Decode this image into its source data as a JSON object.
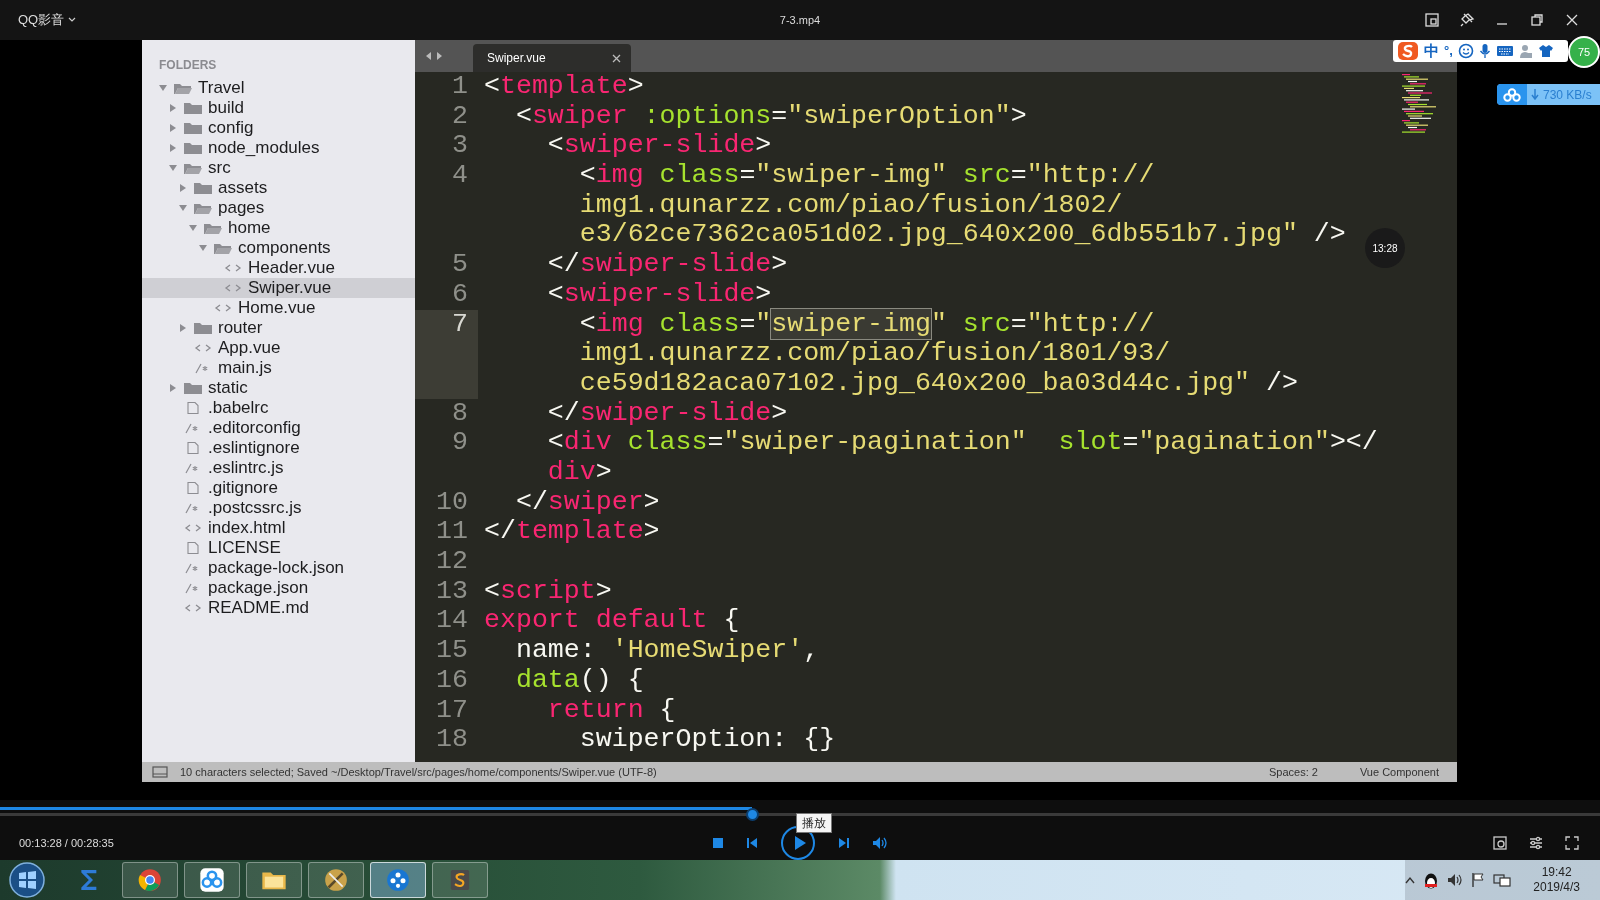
{
  "player": {
    "title": "QQ影音",
    "file": "7-3.mp4"
  },
  "editor": {
    "tab": {
      "label": "Swiper.vue"
    },
    "sidebar": {
      "heading": "FOLDERS",
      "items": [
        {
          "label": "Travel",
          "kind": "folder",
          "expanded": true,
          "selected": false,
          "children": [
            {
              "label": "build",
              "kind": "folder",
              "expanded": false,
              "selected": false
            },
            {
              "label": "config",
              "kind": "folder",
              "expanded": false,
              "selected": false
            },
            {
              "label": "node_modules",
              "kind": "folder",
              "expanded": false,
              "selected": false
            },
            {
              "label": "src",
              "kind": "folder",
              "expanded": true,
              "selected": false,
              "children": [
                {
                  "label": "assets",
                  "kind": "folder",
                  "expanded": false,
                  "selected": false
                },
                {
                  "label": "pages",
                  "kind": "folder",
                  "expanded": true,
                  "selected": false,
                  "children": [
                    {
                      "label": "home",
                      "kind": "folder",
                      "expanded": true,
                      "selected": false,
                      "children": [
                        {
                          "label": "components",
                          "kind": "folder",
                          "expanded": true,
                          "selected": false,
                          "children": [
                            {
                              "label": "Header.vue",
                              "kind": "markup",
                              "selected": false
                            },
                            {
                              "label": "Swiper.vue",
                              "kind": "markup",
                              "selected": true
                            }
                          ]
                        },
                        {
                          "label": "Home.vue",
                          "kind": "markup",
                          "selected": false
                        }
                      ]
                    }
                  ]
                },
                {
                  "label": "router",
                  "kind": "folder",
                  "expanded": false,
                  "selected": false
                },
                {
                  "label": "App.vue",
                  "kind": "markup",
                  "selected": false
                },
                {
                  "label": "main.js",
                  "kind": "script",
                  "selected": false
                }
              ]
            },
            {
              "label": "static",
              "kind": "folder",
              "expanded": false,
              "selected": false
            },
            {
              "label": ".babelrc",
              "kind": "text",
              "selected": false
            },
            {
              "label": ".editorconfig",
              "kind": "script",
              "selected": false
            },
            {
              "label": ".eslintignore",
              "kind": "text",
              "selected": false
            },
            {
              "label": ".eslintrc.js",
              "kind": "script",
              "selected": false
            },
            {
              "label": ".gitignore",
              "kind": "text",
              "selected": false
            },
            {
              "label": ".postcssrc.js",
              "kind": "script",
              "selected": false
            },
            {
              "label": "index.html",
              "kind": "markup",
              "selected": false
            },
            {
              "label": "LICENSE",
              "kind": "text",
              "selected": false
            },
            {
              "label": "package-lock.json",
              "kind": "script",
              "selected": false
            },
            {
              "label": "package.json",
              "kind": "script",
              "selected": false
            },
            {
              "label": "README.md",
              "kind": "markup",
              "selected": false
            }
          ]
        }
      ]
    },
    "lines": [
      {
        "number": "1",
        "current": false,
        "rows": [
          {
            "tokens": [
              {
                "kind": "plain",
                "text": "<"
              },
              {
                "kind": "tag",
                "text": "template"
              },
              {
                "kind": "plain",
                "text": ">"
              }
            ]
          }
        ]
      },
      {
        "number": "2",
        "current": false,
        "rows": [
          {
            "tokens": [
              {
                "kind": "plain",
                "text": "  <"
              },
              {
                "kind": "tag",
                "text": "swiper"
              },
              {
                "kind": "attr",
                "text": " :options"
              },
              {
                "kind": "plain",
                "text": "="
              },
              {
                "kind": "string",
                "text": "\"swiperOption\""
              },
              {
                "kind": "plain",
                "text": ">"
              }
            ]
          }
        ]
      },
      {
        "number": "3",
        "current": false,
        "rows": [
          {
            "tokens": [
              {
                "kind": "plain",
                "text": "    <"
              },
              {
                "kind": "tag",
                "text": "swiper-slide"
              },
              {
                "kind": "plain",
                "text": ">"
              }
            ]
          }
        ]
      },
      {
        "number": "4",
        "current": false,
        "rows": [
          {
            "tokens": [
              {
                "kind": "plain",
                "text": "      <"
              },
              {
                "kind": "tag",
                "text": "img"
              },
              {
                "kind": "attr",
                "text": " class"
              },
              {
                "kind": "plain",
                "text": "="
              },
              {
                "kind": "string",
                "text": "\"swiper-img\""
              },
              {
                "kind": "attr",
                "text": " src"
              },
              {
                "kind": "plain",
                "text": "="
              },
              {
                "kind": "string",
                "text": "\"http://"
              }
            ]
          },
          {
            "tokens": [
              {
                "kind": "string",
                "text": "      img1.qunarzz.com/piao/fusion/1802/"
              }
            ]
          },
          {
            "tokens": [
              {
                "kind": "string",
                "text": "      e3/62ce7362ca051d02.jpg_640x200_6db551b7.jpg\""
              },
              {
                "kind": "plain",
                "text": " />"
              }
            ]
          }
        ]
      },
      {
        "number": "5",
        "current": false,
        "rows": [
          {
            "tokens": [
              {
                "kind": "plain",
                "text": "    </"
              },
              {
                "kind": "tag",
                "text": "swiper-slide"
              },
              {
                "kind": "plain",
                "text": ">"
              }
            ]
          }
        ]
      },
      {
        "number": "6",
        "current": false,
        "rows": [
          {
            "tokens": [
              {
                "kind": "plain",
                "text": "    <"
              },
              {
                "kind": "tag",
                "text": "swiper-slide"
              },
              {
                "kind": "plain",
                "text": ">"
              }
            ]
          }
        ]
      },
      {
        "number": "7",
        "current": true,
        "rows": [
          {
            "tokens": [
              {
                "kind": "plain",
                "text": "      <"
              },
              {
                "kind": "tag",
                "text": "img"
              },
              {
                "kind": "attr",
                "text": " class"
              },
              {
                "kind": "plain",
                "text": "="
              },
              {
                "kind": "string",
                "text": "\""
              },
              {
                "kind": "selection",
                "text": "swiper-img"
              },
              {
                "kind": "string",
                "text": "\""
              },
              {
                "kind": "attr",
                "text": " src"
              },
              {
                "kind": "plain",
                "text": "="
              },
              {
                "kind": "string",
                "text": "\"http://"
              }
            ]
          },
          {
            "tokens": [
              {
                "kind": "string",
                "text": "      img1.qunarzz.com/piao/fusion/1801/93/"
              }
            ]
          },
          {
            "tokens": [
              {
                "kind": "string",
                "text": "      ce59d182aca07102.jpg_640x200_ba03d44c.jpg\""
              },
              {
                "kind": "plain",
                "text": " />"
              }
            ]
          }
        ]
      },
      {
        "number": "8",
        "current": false,
        "rows": [
          {
            "tokens": [
              {
                "kind": "plain",
                "text": "    </"
              },
              {
                "kind": "tag",
                "text": "swiper-slide"
              },
              {
                "kind": "plain",
                "text": ">"
              }
            ]
          }
        ]
      },
      {
        "number": "9",
        "current": false,
        "rows": [
          {
            "tokens": [
              {
                "kind": "plain",
                "text": "    <"
              },
              {
                "kind": "tag",
                "text": "div"
              },
              {
                "kind": "attr",
                "text": " class"
              },
              {
                "kind": "plain",
                "text": "="
              },
              {
                "kind": "string",
                "text": "\"swiper-pagination\""
              },
              {
                "kind": "attr",
                "text": "  slot"
              },
              {
                "kind": "plain",
                "text": "="
              },
              {
                "kind": "string",
                "text": "\"pagination\""
              },
              {
                "kind": "plain",
                "text": "></"
              }
            ]
          },
          {
            "tokens": [
              {
                "kind": "tag",
                "text": "    div"
              },
              {
                "kind": "plain",
                "text": ">"
              }
            ]
          }
        ]
      },
      {
        "number": "10",
        "current": false,
        "rows": [
          {
            "tokens": [
              {
                "kind": "plain",
                "text": "  </"
              },
              {
                "kind": "tag",
                "text": "swiper"
              },
              {
                "kind": "plain",
                "text": ">"
              }
            ]
          }
        ]
      },
      {
        "number": "11",
        "current": false,
        "rows": [
          {
            "tokens": [
              {
                "kind": "plain",
                "text": "</"
              },
              {
                "kind": "tag",
                "text": "template"
              },
              {
                "kind": "plain",
                "text": ">"
              }
            ]
          }
        ]
      },
      {
        "number": "12",
        "current": false
      },
      {
        "number": "13",
        "current": false,
        "rows": [
          {
            "tokens": [
              {
                "kind": "plain",
                "text": "<"
              },
              {
                "kind": "tag",
                "text": "script"
              },
              {
                "kind": "plain",
                "text": ">"
              }
            ]
          }
        ]
      },
      {
        "number": "14",
        "current": false,
        "rows": [
          {
            "tokens": [
              {
                "kind": "keyword",
                "text": "export default"
              },
              {
                "kind": "plain",
                "text": " {"
              }
            ]
          }
        ]
      },
      {
        "number": "15",
        "current": false,
        "rows": [
          {
            "tokens": [
              {
                "kind": "plain",
                "text": "  name: "
              },
              {
                "kind": "string",
                "text": "'HomeSwiper'"
              },
              {
                "kind": "plain",
                "text": ","
              }
            ]
          }
        ]
      },
      {
        "number": "16",
        "current": false,
        "rows": [
          {
            "tokens": [
              {
                "kind": "function",
                "text": "  data"
              },
              {
                "kind": "plain",
                "text": "() {"
              }
            ]
          }
        ]
      },
      {
        "number": "17",
        "current": false,
        "rows": [
          {
            "tokens": [
              {
                "kind": "keyword",
                "text": "    return"
              },
              {
                "kind": "plain",
                "text": " {"
              }
            ]
          }
        ]
      },
      {
        "number": "18",
        "current": false,
        "rows": [
          {
            "tokens": [
              {
                "kind": "plain",
                "text": "      swiperOption: {}"
              }
            ]
          }
        ]
      }
    ],
    "status": {
      "message": "10 characters selected; Saved ~/Desktop/Travel/src/pages/home/components/Swiper.vue (UTF-8)",
      "spaces": "Spaces: 2",
      "syntax": "Vue Component"
    }
  },
  "overlay": {
    "time_bubble": "13:28",
    "ime": {
      "language": "中",
      "punctuation": "°,"
    },
    "download": {
      "speed": "730 KB/s"
    },
    "badge": "75"
  },
  "playback": {
    "level": 0.47,
    "time": "00:13:28 / 00:28:35",
    "tooltip": "播放"
  },
  "taskbar": {
    "apps": [
      {
        "kind": "sigma",
        "selected": false
      },
      {
        "kind": "browser",
        "selected": false
      },
      {
        "kind": "cloud",
        "selected": false
      },
      {
        "kind": "folder",
        "selected": false
      },
      {
        "kind": "tool",
        "selected": false
      },
      {
        "kind": "player",
        "selected": true
      },
      {
        "kind": "editor",
        "selected": false
      }
    ],
    "time": "19:42",
    "date": "2019/4/3"
  }
}
